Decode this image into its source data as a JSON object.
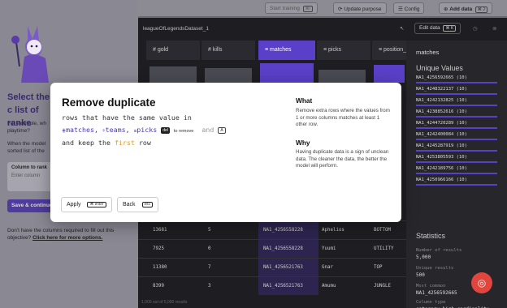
{
  "toolbar": {
    "start_training": "Start training",
    "start_training_key": "⌘/",
    "update_purpose": "Update purpose",
    "config": "Config",
    "add_data": "Add data",
    "add_data_keys": "⌘ J"
  },
  "left": {
    "title": "Select the c list of ranke",
    "p1": "For example, wh playtime?",
    "p2": "When the model sorted list of the",
    "column_label": "Column to rank",
    "column_placeholder": "Enter column",
    "save_label": "Save & continue",
    "note_text": "Don't have the columns required to fill out this objective?",
    "note_link": "Click here for more options."
  },
  "dataset": {
    "title": "leagueOfLegendsDataset_1",
    "edit_label": "Edit data",
    "edit_keys": "⌘ K",
    "columns": [
      {
        "label": "# gold"
      },
      {
        "label": "# kills"
      },
      {
        "label": "≡ matches"
      },
      {
        "label": "≡ picks"
      },
      {
        "label": "≡ position_"
      }
    ],
    "rows": [
      {
        "gold": "13681",
        "kills": "5",
        "matches": "NA1_4256558228",
        "picks": "Aphelios",
        "pos": "BOTTOM"
      },
      {
        "gold": "7925",
        "kills": "0",
        "matches": "NA1_4256558228",
        "picks": "Yuumi",
        "pos": "UTILITY"
      },
      {
        "gold": "11380",
        "kills": "7",
        "matches": "NA1_4256521763",
        "picks": "Gnar",
        "pos": "TOP"
      },
      {
        "gold": "8399",
        "kills": "3",
        "matches": "NA1_4256521763",
        "picks": "Amumu",
        "pos": "JUNGLE"
      }
    ],
    "footnote": "1,000 out of 5,000 results"
  },
  "side": {
    "header": "matches",
    "unique_title": "Unique Values",
    "unique_values": [
      "NA1_4256592665 (10)",
      "NA1_4248322137 (10)",
      "NA1_4242132825 (10)",
      "NA1_4238852616 (10)",
      "NA1_4244720289 (10)",
      "NA1_4242400084 (10)",
      "NA1_4245287919 (10)",
      "NA1_4253805593 (10)",
      "NA1_4242189756 (10)",
      "NA1_4250966166 (10)"
    ],
    "stats_title": "Statistics",
    "stats": [
      {
        "label": "Number of results",
        "value": "5,000"
      },
      {
        "label": "Unique results",
        "value": "500"
      },
      {
        "label": "Most common",
        "value": "NA1_4256592665"
      },
      {
        "label": "Column type",
        "value": "category_high_cardinality"
      }
    ]
  },
  "modal": {
    "title": "Remove duplicate",
    "line1": "rows that have the same value in",
    "tok_matches": "matches",
    "tok_teams": "teams",
    "tok_picks": "picks",
    "comma": ",",
    "del_key": "del",
    "to_remove": "to remove",
    "and": "and",
    "a_key": "A",
    "line3_pre": "and keep the",
    "line3_first": "first",
    "line3_post": "row",
    "what_title": "What",
    "what_text": "Remove extra rows where the values from 1 or more columns matches at least 1 other row.",
    "why_title": "Why",
    "why_text": "Having duplicate data is a sign of unclean data. The cleaner the data, the better the model will perform.",
    "apply_label": "Apply",
    "apply_key": "⌘ enter",
    "back_label": "Back",
    "back_key": "esc"
  }
}
